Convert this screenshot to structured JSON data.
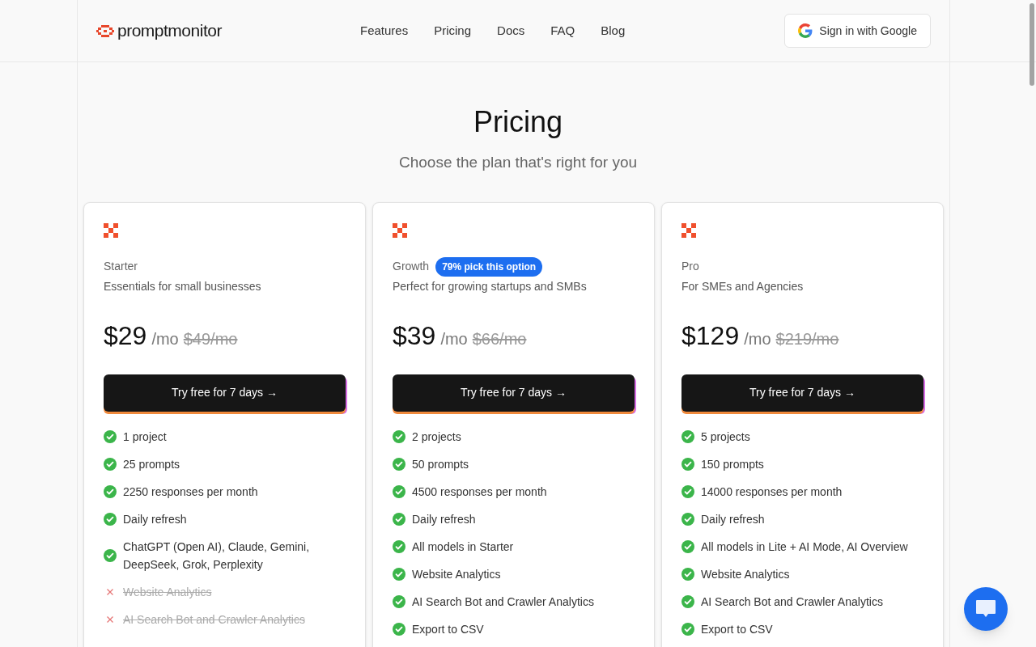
{
  "header": {
    "logo": "promptmonitor",
    "nav": [
      "Features",
      "Pricing",
      "Docs",
      "FAQ",
      "Blog"
    ],
    "sign_in": "Sign in with Google"
  },
  "hero": {
    "title": "Pricing",
    "subtitle": "Choose the plan that's right for you"
  },
  "plans": [
    {
      "name": "Starter",
      "description": "Essentials for small businesses",
      "price": "$29",
      "period": "/mo",
      "old_price": "$49/mo",
      "cta": "Try free for 7 days →",
      "features": [
        {
          "text": "1 project",
          "included": true
        },
        {
          "text": "25 prompts",
          "included": true
        },
        {
          "text": "2250 responses per month",
          "included": true
        },
        {
          "text": "Daily refresh",
          "included": true
        },
        {
          "text": "ChatGPT (Open AI), Claude, Gemini, DeepSeek, Grok, Perplexity",
          "included": true
        },
        {
          "text": "Website Analytics",
          "included": false
        },
        {
          "text": "AI Search Bot and Crawler Analytics",
          "included": false
        }
      ]
    },
    {
      "name": "Growth",
      "badge": "79% pick this option",
      "description": "Perfect for growing startups and SMBs",
      "price": "$39",
      "period": "/mo",
      "old_price": "$66/mo",
      "cta": "Try free for 7 days →",
      "features": [
        {
          "text": "2 projects",
          "included": true
        },
        {
          "text": "50 prompts",
          "included": true
        },
        {
          "text": "4500 responses per month",
          "included": true
        },
        {
          "text": "Daily refresh",
          "included": true
        },
        {
          "text": "All models in Starter",
          "included": true
        },
        {
          "text": "Website Analytics",
          "included": true
        },
        {
          "text": "AI Search Bot and Crawler Analytics",
          "included": true
        },
        {
          "text": "Export to CSV",
          "included": true
        }
      ]
    },
    {
      "name": "Pro",
      "description": "For SMEs and Agencies",
      "price": "$129",
      "period": "/mo",
      "old_price": "$219/mo",
      "cta": "Try free for 7 days →",
      "features": [
        {
          "text": "5 projects",
          "included": true
        },
        {
          "text": "150 prompts",
          "included": true
        },
        {
          "text": "14000 responses per month",
          "included": true
        },
        {
          "text": "Daily refresh",
          "included": true
        },
        {
          "text": "All models in Lite + AI Mode, AI Overview",
          "included": true
        },
        {
          "text": "Website Analytics",
          "included": true
        },
        {
          "text": "AI Search Bot and Crawler Analytics",
          "included": true
        },
        {
          "text": "Export to CSV",
          "included": true
        }
      ]
    }
  ]
}
